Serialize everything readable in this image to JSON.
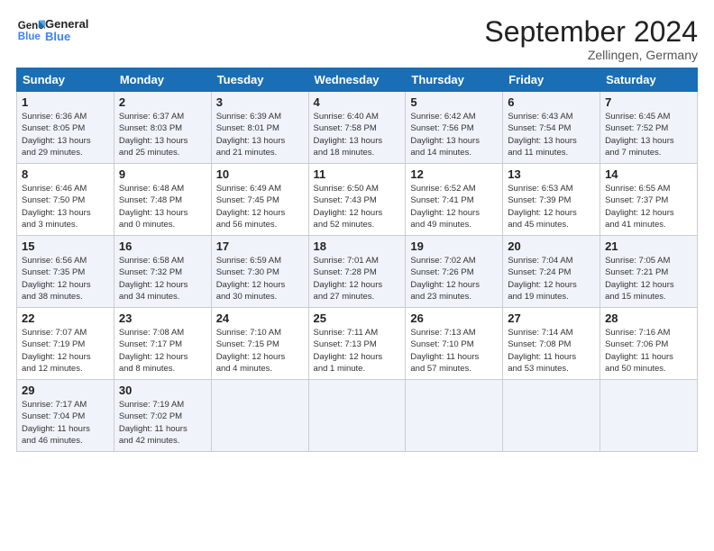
{
  "header": {
    "logo_line1": "General",
    "logo_line2": "Blue",
    "month": "September 2024",
    "location": "Zellingen, Germany"
  },
  "days_of_week": [
    "Sunday",
    "Monday",
    "Tuesday",
    "Wednesday",
    "Thursday",
    "Friday",
    "Saturday"
  ],
  "weeks": [
    [
      {
        "day": "1",
        "info": "Sunrise: 6:36 AM\nSunset: 8:05 PM\nDaylight: 13 hours\nand 29 minutes."
      },
      {
        "day": "2",
        "info": "Sunrise: 6:37 AM\nSunset: 8:03 PM\nDaylight: 13 hours\nand 25 minutes."
      },
      {
        "day": "3",
        "info": "Sunrise: 6:39 AM\nSunset: 8:01 PM\nDaylight: 13 hours\nand 21 minutes."
      },
      {
        "day": "4",
        "info": "Sunrise: 6:40 AM\nSunset: 7:58 PM\nDaylight: 13 hours\nand 18 minutes."
      },
      {
        "day": "5",
        "info": "Sunrise: 6:42 AM\nSunset: 7:56 PM\nDaylight: 13 hours\nand 14 minutes."
      },
      {
        "day": "6",
        "info": "Sunrise: 6:43 AM\nSunset: 7:54 PM\nDaylight: 13 hours\nand 11 minutes."
      },
      {
        "day": "7",
        "info": "Sunrise: 6:45 AM\nSunset: 7:52 PM\nDaylight: 13 hours\nand 7 minutes."
      }
    ],
    [
      {
        "day": "8",
        "info": "Sunrise: 6:46 AM\nSunset: 7:50 PM\nDaylight: 13 hours\nand 3 minutes."
      },
      {
        "day": "9",
        "info": "Sunrise: 6:48 AM\nSunset: 7:48 PM\nDaylight: 13 hours\nand 0 minutes."
      },
      {
        "day": "10",
        "info": "Sunrise: 6:49 AM\nSunset: 7:45 PM\nDaylight: 12 hours\nand 56 minutes."
      },
      {
        "day": "11",
        "info": "Sunrise: 6:50 AM\nSunset: 7:43 PM\nDaylight: 12 hours\nand 52 minutes."
      },
      {
        "day": "12",
        "info": "Sunrise: 6:52 AM\nSunset: 7:41 PM\nDaylight: 12 hours\nand 49 minutes."
      },
      {
        "day": "13",
        "info": "Sunrise: 6:53 AM\nSunset: 7:39 PM\nDaylight: 12 hours\nand 45 minutes."
      },
      {
        "day": "14",
        "info": "Sunrise: 6:55 AM\nSunset: 7:37 PM\nDaylight: 12 hours\nand 41 minutes."
      }
    ],
    [
      {
        "day": "15",
        "info": "Sunrise: 6:56 AM\nSunset: 7:35 PM\nDaylight: 12 hours\nand 38 minutes."
      },
      {
        "day": "16",
        "info": "Sunrise: 6:58 AM\nSunset: 7:32 PM\nDaylight: 12 hours\nand 34 minutes."
      },
      {
        "day": "17",
        "info": "Sunrise: 6:59 AM\nSunset: 7:30 PM\nDaylight: 12 hours\nand 30 minutes."
      },
      {
        "day": "18",
        "info": "Sunrise: 7:01 AM\nSunset: 7:28 PM\nDaylight: 12 hours\nand 27 minutes."
      },
      {
        "day": "19",
        "info": "Sunrise: 7:02 AM\nSunset: 7:26 PM\nDaylight: 12 hours\nand 23 minutes."
      },
      {
        "day": "20",
        "info": "Sunrise: 7:04 AM\nSunset: 7:24 PM\nDaylight: 12 hours\nand 19 minutes."
      },
      {
        "day": "21",
        "info": "Sunrise: 7:05 AM\nSunset: 7:21 PM\nDaylight: 12 hours\nand 15 minutes."
      }
    ],
    [
      {
        "day": "22",
        "info": "Sunrise: 7:07 AM\nSunset: 7:19 PM\nDaylight: 12 hours\nand 12 minutes."
      },
      {
        "day": "23",
        "info": "Sunrise: 7:08 AM\nSunset: 7:17 PM\nDaylight: 12 hours\nand 8 minutes."
      },
      {
        "day": "24",
        "info": "Sunrise: 7:10 AM\nSunset: 7:15 PM\nDaylight: 12 hours\nand 4 minutes."
      },
      {
        "day": "25",
        "info": "Sunrise: 7:11 AM\nSunset: 7:13 PM\nDaylight: 12 hours\nand 1 minute."
      },
      {
        "day": "26",
        "info": "Sunrise: 7:13 AM\nSunset: 7:10 PM\nDaylight: 11 hours\nand 57 minutes."
      },
      {
        "day": "27",
        "info": "Sunrise: 7:14 AM\nSunset: 7:08 PM\nDaylight: 11 hours\nand 53 minutes."
      },
      {
        "day": "28",
        "info": "Sunrise: 7:16 AM\nSunset: 7:06 PM\nDaylight: 11 hours\nand 50 minutes."
      }
    ],
    [
      {
        "day": "29",
        "info": "Sunrise: 7:17 AM\nSunset: 7:04 PM\nDaylight: 11 hours\nand 46 minutes."
      },
      {
        "day": "30",
        "info": "Sunrise: 7:19 AM\nSunset: 7:02 PM\nDaylight: 11 hours\nand 42 minutes."
      },
      {
        "day": "",
        "info": ""
      },
      {
        "day": "",
        "info": ""
      },
      {
        "day": "",
        "info": ""
      },
      {
        "day": "",
        "info": ""
      },
      {
        "day": "",
        "info": ""
      }
    ]
  ]
}
